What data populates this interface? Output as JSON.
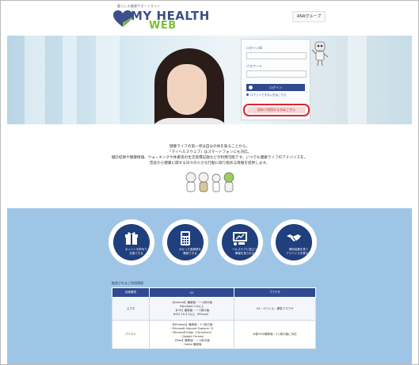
{
  "header": {
    "tagline": "暮らしの健康サポートサイト",
    "logo_line1": "MY HEALTH",
    "logo_line2": "WEB",
    "link_label": "ANAグループ"
  },
  "login": {
    "id_label": "ログインID",
    "password_label": "パスワード",
    "id_value": "",
    "password_value": "",
    "login_button": "ログイン",
    "forgot_note": "ログインできない方はこちら",
    "register_button": "初めて利用する方はこちら"
  },
  "intro": {
    "lines": [
      "健康ライフの第一歩は自分の体を知ることから。",
      "「マイヘルスウェブ」はスマートフォンにも対応。",
      "健診結果や健康情報、ウォーキングや体重等の生活習慣記録などが利用可能です。いつでも健康ライフのアドバイスを。",
      "普段から健康に関する日々の小さな行動に取り組める情報を提供します。"
    ]
  },
  "features": [
    {
      "icon": "gift-icon",
      "caption_1": "ポイントを貯めて",
      "caption_2": "交換できる"
    },
    {
      "icon": "calculator-icon",
      "caption_1": "かかった医療費を",
      "caption_2": "確認できる"
    },
    {
      "icon": "presentation-icon",
      "caption_1": "ヘルスケアに役立つ",
      "caption_2": "情報を見られる"
    },
    {
      "icon": "handshake-icon",
      "caption_1": "健診結果を見て",
      "caption_2": "アドバイスを受ける"
    }
  ],
  "env_table": {
    "title": "推奨されるご利用環境",
    "headers": [
      "利用環境",
      "OS",
      "ブラウザ"
    ],
    "rows": [
      {
        "device": "スマホ",
        "os": [
          "【Android】最新版・一つ前の版",
          "※Android 5.0以上",
          "【iOS】最新版・一つ前の版",
          "※iOS 10.3.3以上（iPhone）"
        ],
        "browser": "OS・デバイス：標準ブラウザ"
      },
      {
        "device": "パソコン",
        "os": [
          "【Windows】最新版・1つ前の版",
          "・Microsoft Internet Explorer 11",
          "・Microsoft Edge（Chromium）",
          "・Google Chrome",
          "【Mac】最新版・一つ前の版",
          "・Safari 最新版"
        ],
        "browser": "※各OSの最新版・1つ前の版に対応"
      }
    ]
  },
  "colors": {
    "brand_navy": "#2f4a8f",
    "brand_green": "#7cbf3b",
    "highlight_red": "#e0242b",
    "section_blue": "#9fc5e6"
  }
}
